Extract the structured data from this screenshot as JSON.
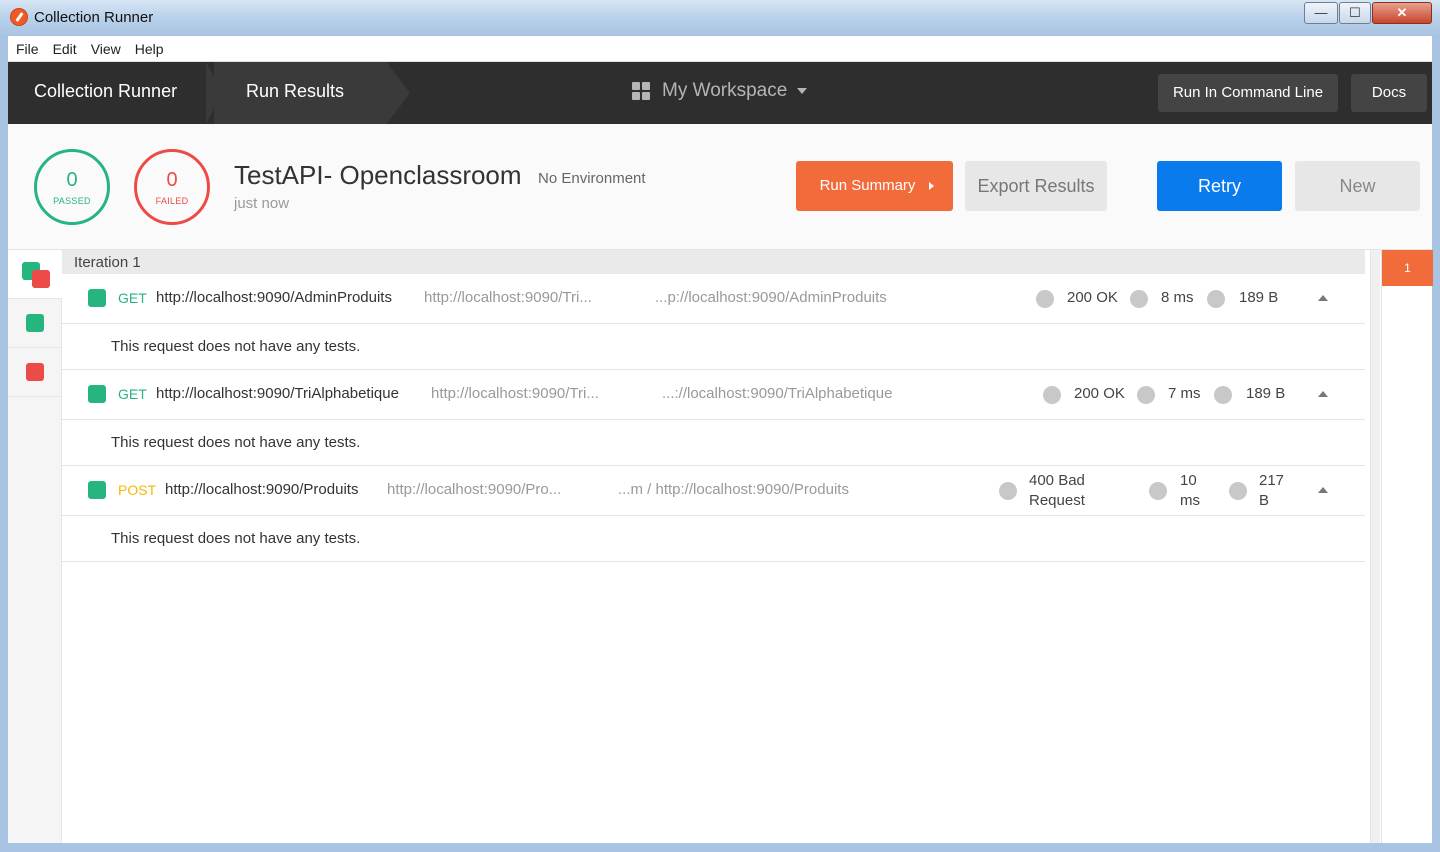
{
  "window": {
    "title": "Collection Runner",
    "controls": {
      "minimize": "—",
      "maximize": "☐",
      "close": "✕"
    }
  },
  "menu": [
    "File",
    "Edit",
    "View",
    "Help"
  ],
  "header": {
    "crumb_runner": "Collection Runner",
    "crumb_results": "Run Results",
    "workspace": "My Workspace",
    "cli_button": "Run In Command Line",
    "docs_button": "Docs"
  },
  "summary": {
    "passed_count": "0",
    "passed_label": "PASSED",
    "failed_count": "0",
    "failed_label": "FAILED",
    "collection_name": "TestAPI- Openclassroom",
    "environment": "No Environment",
    "time": "just now",
    "run_summary": "Run Summary",
    "export_results": "Export Results",
    "retry": "Retry",
    "new": "New"
  },
  "iteration": {
    "label": "Iteration 1",
    "badge": "1"
  },
  "requests": [
    {
      "method": "GET",
      "url": "http://localhost:9090/AdminProduits",
      "short_url": "http://localhost:9090/Tri...",
      "path_url": "...p://localhost:9090/AdminProduits",
      "status": "200 OK",
      "time": "8 ms",
      "size": "189 B",
      "tests": "This request does not have any tests."
    },
    {
      "method": "GET",
      "url": "http://localhost:9090/TriAlphabetique",
      "short_url": "http://localhost:9090/Tri...",
      "path_url": "...://localhost:9090/TriAlphabetique",
      "status": "200 OK",
      "time": "7 ms",
      "size": "189 B",
      "tests": "This request does not have any tests."
    },
    {
      "method": "POST",
      "url": "http://localhost:9090/Produits",
      "short_url": "http://localhost:9090/Pro...",
      "path_url": "...m / http://localhost:9090/Produits",
      "status_line1": "400 Bad",
      "status_line2": "Request",
      "time_line1": "10",
      "time_line2": "ms",
      "size_line1": "217",
      "size_line2": "B",
      "tests": "This request does not have any tests."
    }
  ],
  "colors": {
    "pass": "#26b47f",
    "fail": "#ed4b48",
    "accent": "#f26b3a",
    "primary": "#097bed",
    "header_bg": "#2e2e2e"
  }
}
